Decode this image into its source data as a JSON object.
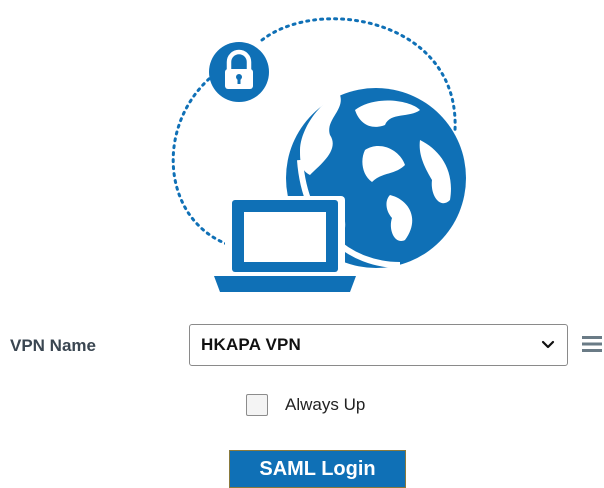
{
  "colors": {
    "brand_blue": "#0f70b6",
    "label_gray": "#3a4651"
  },
  "illustration": {
    "icons": [
      "lock-icon",
      "globe-icon",
      "laptop-icon"
    ]
  },
  "form": {
    "vpn_name_label": "VPN Name",
    "vpn_selected": "HKAPA VPN",
    "always_up_label": "Always Up",
    "always_up_checked": false,
    "saml_login_label": "SAML Login"
  }
}
